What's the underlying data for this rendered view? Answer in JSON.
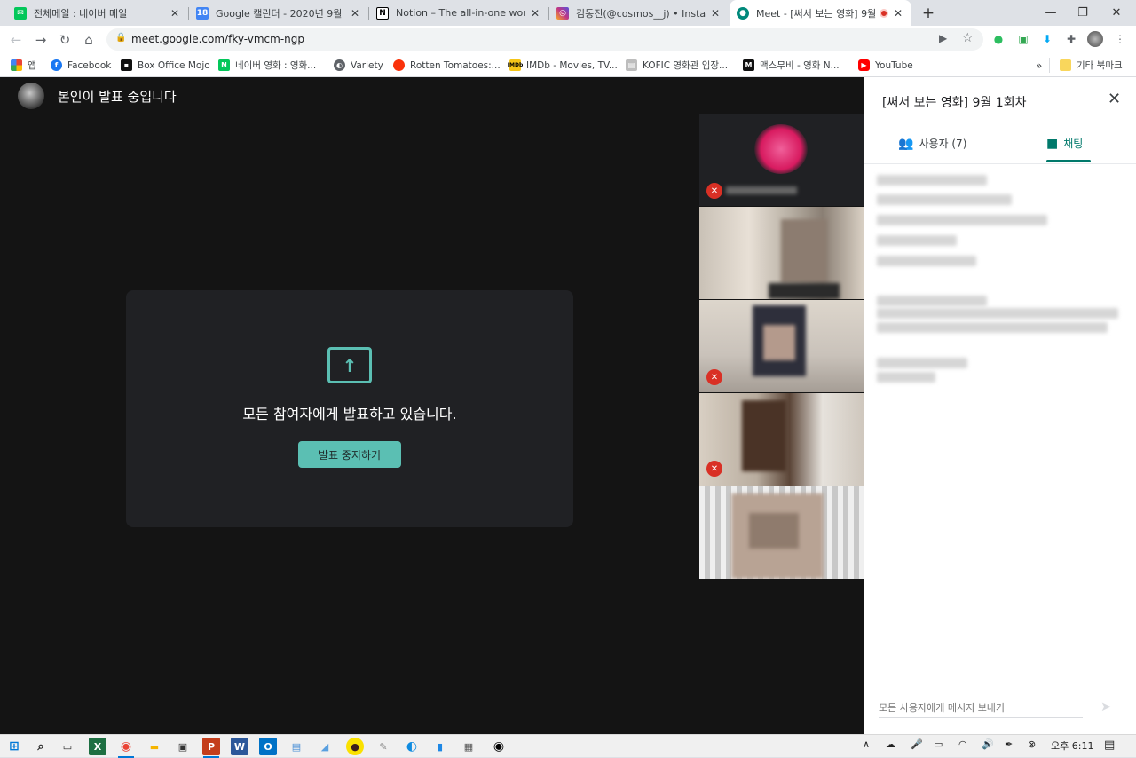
{
  "tabs": [
    {
      "title": "전체메일 : 네이버 메일",
      "icon": "naver-mail-icon",
      "color": "#03c75a"
    },
    {
      "title": "Google 캘린더 - 2020년 9월",
      "icon": "google-calendar-icon",
      "color": "#4285f4"
    },
    {
      "title": "Notion – The all-in-one workspace",
      "icon": "notion-icon",
      "color": "#000000"
    },
    {
      "title": "김동진(@cosmos__j) • Instagram",
      "icon": "instagram-icon",
      "color": "#c13584"
    },
    {
      "title": "Meet - [써서 보는 영화] 9월",
      "icon": "google-meet-icon",
      "color": "#00897b"
    }
  ],
  "address": {
    "url": "meet.google.com/fky-vmcm-ngp"
  },
  "bookmarks": [
    {
      "label": "앱",
      "icon": "apps-grid-icon"
    },
    {
      "label": "Facebook",
      "icon": "facebook-icon"
    },
    {
      "label": "Box Office Mojo",
      "icon": "box-office-mojo-icon"
    },
    {
      "label": "네이버 영화 : 영화...",
      "icon": "naver-icon"
    },
    {
      "label": "Variety",
      "icon": "variety-icon"
    },
    {
      "label": "Rotten Tomatoes:...",
      "icon": "tomato-icon"
    },
    {
      "label": "IMDb - Movies, TV...",
      "icon": "imdb-icon"
    },
    {
      "label": "KOFIC 영화관 입장...",
      "icon": "kofic-icon"
    },
    {
      "label": "맥스무비 - 영화 N...",
      "icon": "maxmovie-icon"
    },
    {
      "label": "YouTube",
      "icon": "youtube-icon"
    }
  ],
  "bookmarks_more": "»",
  "other_bookmarks": "기타 북마크",
  "meet": {
    "presenting_label": "본인이 발표 중입니다",
    "card_message": "모든 참여자에게 발표하고 있습니다.",
    "stop_button": "발표 중지하기"
  },
  "panel": {
    "title": "[써서 보는 영화] 9월 1회차",
    "people_tab": "사용자 (7)",
    "chat_tab": "채팅",
    "input_placeholder": "모든 사용자에게 메시지 보내기"
  },
  "taskbar": {
    "time": "오후 6:11"
  },
  "colors": {
    "accent": "#5bbfb3",
    "chat_tab_active": "#00796b",
    "meet_background": "#141414",
    "card_background": "#202124",
    "mic_muted": "#d93025"
  }
}
